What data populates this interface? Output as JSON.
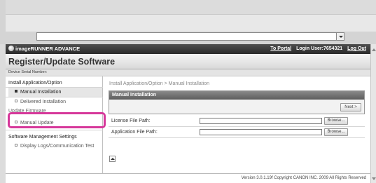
{
  "app": {
    "brand": "imageRUNNER ADVANCE",
    "title": "Register/Update Software",
    "to_portal": "To Portal",
    "login_user": "Login User:7654321",
    "logout": "Log Out"
  },
  "serial": {
    "label": "Device Serial Number:"
  },
  "sidebar": {
    "install_heading": "Install Application/Option",
    "manual_installation": "Manual Installation",
    "delivered_installation": "Delivered Installation",
    "update_heading": "Update Firmware",
    "manual_update": "Manual Update",
    "software_heading": "Software Management Settings",
    "display_logs": "Display Logs/Communication Test"
  },
  "main": {
    "breadcrumb": "Install Application/Option > Manual Installation",
    "panel_title": "Manual Installation",
    "next_label": "Next >",
    "license_label": "License File Path:",
    "license_value": "",
    "app_label": "Application File Path:",
    "app_value": "",
    "browse_label": "Browse..."
  },
  "footer": {
    "text": "Version 3.0.1.19f Copyright CANON INC. 2009 All Rights Reserved"
  },
  "colors": {
    "highlight": "#d6389a",
    "topbar": "#2a2a2a",
    "panel_header": "#5c5c5c"
  },
  "icons": [
    "brand-logo-icon",
    "dropdown-arrow-icon",
    "bullet-icon",
    "back-to-top-icon"
  ]
}
